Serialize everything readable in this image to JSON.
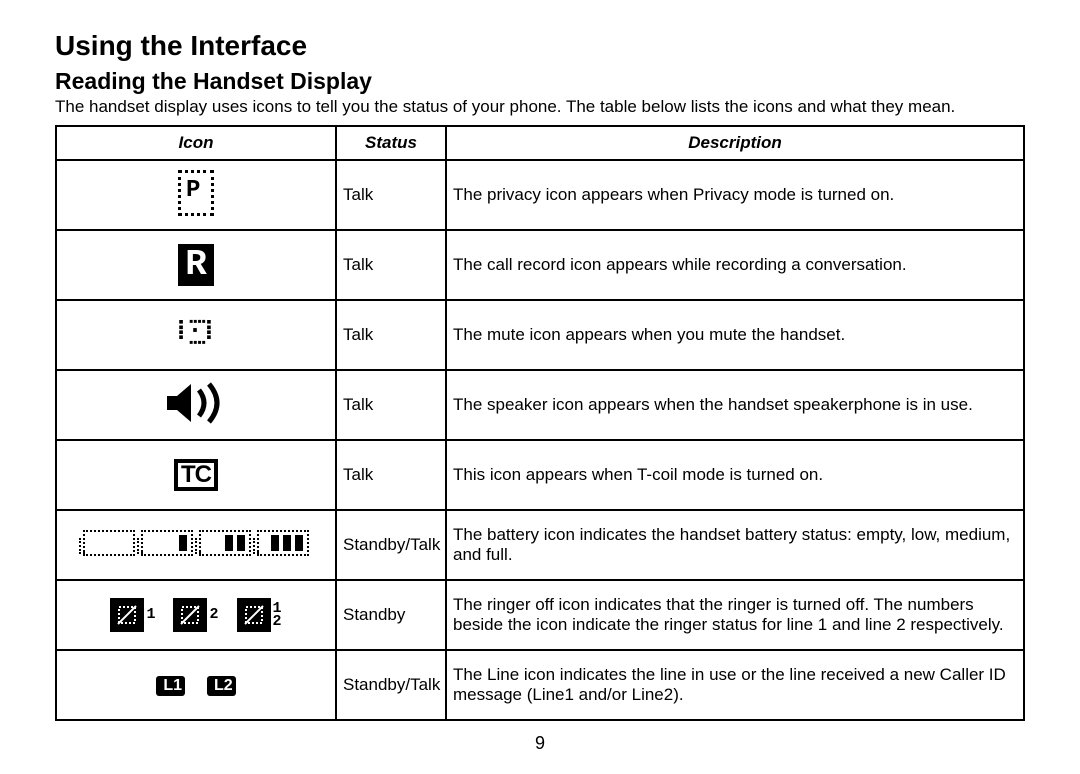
{
  "heading": "Using the Interface",
  "subheading": "Reading the Handset Display",
  "intro": "The handset display uses icons to tell you the status of your phone. The table below lists the icons and what they mean.",
  "columns": {
    "icon": "Icon",
    "status": "Status",
    "desc": "Description"
  },
  "rows": [
    {
      "icon_name": "privacy-icon",
      "status": "Talk",
      "desc": "The privacy icon appears when Privacy mode is turned on."
    },
    {
      "icon_name": "record-icon",
      "status": "Talk",
      "desc": "The call record icon appears while recording a conversation."
    },
    {
      "icon_name": "mute-icon",
      "status": "Talk",
      "desc": "The mute icon appears when you mute the handset."
    },
    {
      "icon_name": "speaker-icon",
      "status": "Talk",
      "desc": "The speaker icon appears when the handset speakerphone is in use."
    },
    {
      "icon_name": "tcoil-icon",
      "status": "Talk",
      "desc": "This icon appears when T-coil mode is turned on."
    },
    {
      "icon_name": "battery-icon",
      "status": "Standby/Talk",
      "desc": "The battery icon indicates the handset battery status: empty, low, medium, and full."
    },
    {
      "icon_name": "ringer-off-icon",
      "status": "Standby",
      "desc": "The ringer off icon indicates that the ringer is turned off. The numbers beside the icon indicate the ringer status for line 1 and line 2 respectively."
    },
    {
      "icon_name": "line-icon",
      "status": "Standby/Talk",
      "desc": "The Line icon indicates the line in use or the line received a new Caller ID message (Line1 and/or Line2)."
    }
  ],
  "icon_labels": {
    "tc": "TC",
    "r": "R",
    "line1": "L1",
    "line2": "L2",
    "ring1": "1",
    "ring2": "2",
    "ring12a": "1",
    "ring12b": "2"
  },
  "page_number": "9"
}
